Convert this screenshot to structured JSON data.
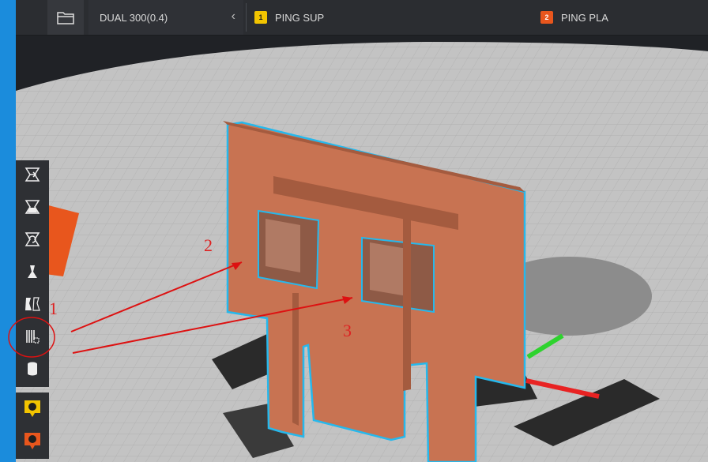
{
  "header": {
    "printer_label": "DUAL 300(0.4)",
    "extruder1": {
      "number": "1",
      "label": "PING SUP",
      "color": "#f2c400"
    },
    "extruder2": {
      "number": "2",
      "label": "PING PLA",
      "color": "#e8561d"
    }
  },
  "toolbar": {
    "tools": [
      {
        "icon": "move-icon"
      },
      {
        "icon": "scale-icon"
      },
      {
        "icon": "rotate-icon"
      },
      {
        "icon": "mirror-icon"
      },
      {
        "icon": "per-model-settings-icon"
      },
      {
        "icon": "support-blocker-icon"
      },
      {
        "icon": "cylinder-icon"
      }
    ],
    "extruders": [
      {
        "number": "1",
        "color": "#f2c400"
      },
      {
        "number": "2",
        "color": "#e8561d"
      }
    ]
  },
  "annotations": {
    "label1": "1",
    "label2": "2",
    "label3": "3"
  },
  "colors": {
    "model": "#c87352",
    "outline": "#26b8ec",
    "bed": "#bdbdbd",
    "background": "#202226",
    "annotation": "#dd1111"
  }
}
